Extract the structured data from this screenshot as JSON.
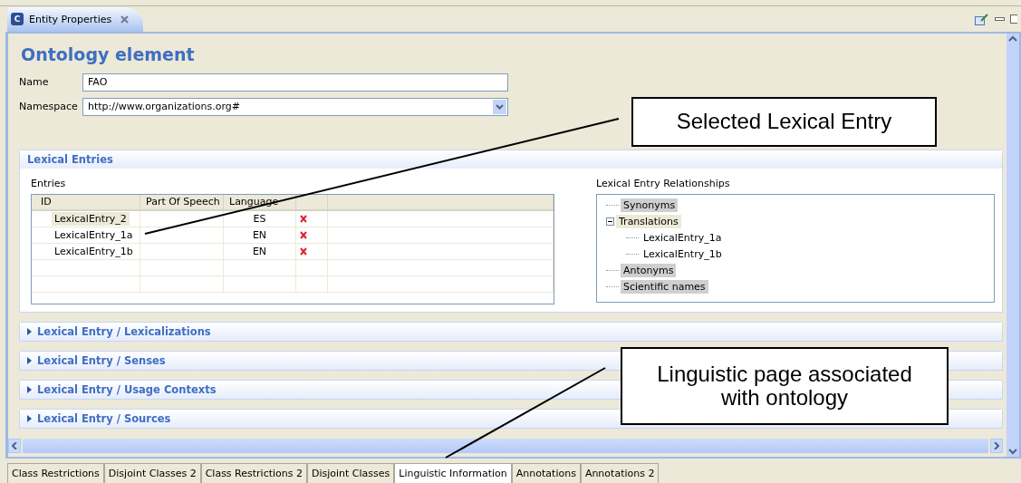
{
  "view_tab": {
    "title": "Entity Properties",
    "icon_letter": "C"
  },
  "heading": "Ontology element",
  "form": [
    {
      "kind": "text",
      "label": "Name",
      "value": "FAO"
    },
    {
      "kind": "dropdown",
      "label": "Namespace",
      "value": "http://www.organizations.org#"
    }
  ],
  "sections": [
    {
      "title": "Lexical Entries",
      "expanded": true
    },
    {
      "title": "Lexical Entry / Lexicalizations",
      "expanded": false
    },
    {
      "title": "Lexical Entry / Senses",
      "expanded": false
    },
    {
      "title": "Lexical Entry / Usage Contexts",
      "expanded": false
    },
    {
      "title": "Lexical Entry / Sources",
      "expanded": false
    }
  ],
  "entries": {
    "label": "Entries",
    "columns": [
      "ID",
      "Part Of Speech",
      "Language"
    ],
    "rows": [
      {
        "id": "LexicalEntry_2",
        "language": "ES",
        "selected": true
      },
      {
        "id": "LexicalEntry_1a",
        "language": "EN",
        "selected": false
      },
      {
        "id": "LexicalEntry_1b",
        "language": "EN",
        "selected": false
      }
    ]
  },
  "relationships": {
    "label": "Lexical Entry Relationships",
    "items": [
      {
        "label": "Synonyms",
        "highlighted": true,
        "selected": false
      },
      {
        "label": "Translations",
        "highlighted": false,
        "selected": true,
        "expanded": true,
        "children": [
          {
            "label": "LexicalEntry_1a",
            "highlighted": false,
            "selected": false
          },
          {
            "label": "LexicalEntry_1b",
            "highlighted": false,
            "selected": false
          }
        ]
      },
      {
        "label": "Antonyms",
        "highlighted": true,
        "selected": false
      },
      {
        "label": "Scientific names",
        "highlighted": true,
        "selected": false
      }
    ]
  },
  "bottom_tabs": [
    {
      "label": "Class Restrictions",
      "selected": false
    },
    {
      "label": "Disjoint Classes 2",
      "selected": false
    },
    {
      "label": "Class Restrictions 2",
      "selected": false
    },
    {
      "label": "Disjoint Classes",
      "selected": false
    },
    {
      "label": "Linguistic Information",
      "selected": true
    },
    {
      "label": "Annotations",
      "selected": false
    },
    {
      "label": "Annotations 2",
      "selected": false
    }
  ],
  "callouts": [
    {
      "text": "Selected Lexical Entry"
    },
    {
      "text": "Linguistic page associated with ontology"
    }
  ]
}
